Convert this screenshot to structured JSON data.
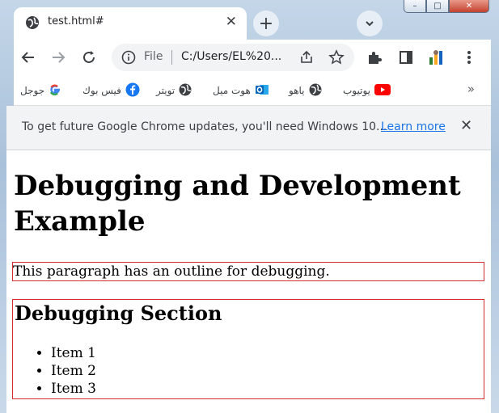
{
  "window": {
    "minimize": "–",
    "maximize": "□",
    "close": "✕"
  },
  "tab": {
    "title": "test.html#",
    "close": "✕"
  },
  "newtab": {
    "label": "+"
  },
  "toolbar": {
    "file_label": "File",
    "url": "C:/Users/EL%20..."
  },
  "bookmarks": [
    {
      "label": "جوجل",
      "icon": "google-icon"
    },
    {
      "label": "فيس بوك",
      "icon": "facebook-icon"
    },
    {
      "label": "تويتر",
      "icon": "globe-icon"
    },
    {
      "label": "هوت ميل",
      "icon": "outlook-icon"
    },
    {
      "label": "ياهو",
      "icon": "globe-icon"
    },
    {
      "label": "يوتيوب",
      "icon": "youtube-icon"
    }
  ],
  "bookmarks_more": "»",
  "infobar": {
    "message": "To get future Google Chrome updates, you'll need Windows 10...",
    "link": "Learn more",
    "close": "✕"
  },
  "page": {
    "heading": "Debugging and Development Example",
    "paragraph": "This paragraph has an outline for debugging.",
    "section_heading": "Debugging Section",
    "items": [
      "Item 1",
      "Item 2",
      "Item 3"
    ]
  },
  "colors": {
    "outline": "#d32f2f",
    "link": "#1a73e8",
    "youtube": "#ff0000",
    "facebook": "#1877f2"
  }
}
